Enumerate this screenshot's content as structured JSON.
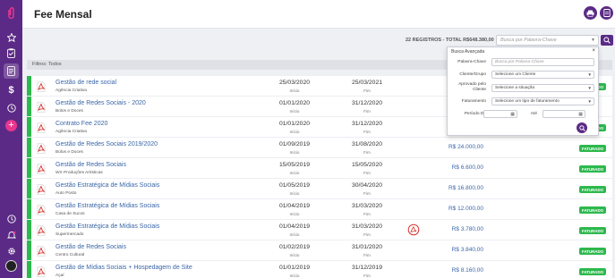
{
  "page": {
    "title": "Fee Mensal"
  },
  "summary": "22 REGISTROS - TOTAL R$648.380,00",
  "search": {
    "placeholder": "Busca por Palavra-Chave"
  },
  "filters": {
    "label": "Filtros: Todos"
  },
  "advanced_search": {
    "title": "Busca Avançada",
    "close": "×",
    "fields": [
      {
        "label": "Palavra-Chave",
        "value": "Busca por Palavra-Chave",
        "placeholder": true
      },
      {
        "label": "Cliente/Grupo",
        "value": "Selecione um Cliente"
      },
      {
        "label": "Aprovado pelo Cliente",
        "value": "Selecione a situação"
      },
      {
        "label": "Faturamento",
        "value": "Selecione um tipo de faturamento"
      }
    ],
    "period_label": "Período De",
    "period_to": "Até"
  },
  "colors": {
    "sidebar": "#5b2a86",
    "accent": "#e8368f",
    "link": "#3a66a8",
    "status": "#2db84d"
  },
  "sidebar": {
    "icons": [
      "logo-icon",
      "star-icon",
      "clipboard-icon",
      "document-icon",
      "dollar-icon",
      "clock-icon",
      "plus-icon",
      "history-icon",
      "bell-icon",
      "gear-icon",
      "avatar"
    ]
  },
  "date_labels": {
    "start": "Início",
    "end": "Fim"
  },
  "rows": [
    {
      "title": "Gestão de rede social",
      "client": "Agência Criativa",
      "start": "25/03/2020",
      "end": "25/03/2021",
      "amount": "",
      "status": "FATURADO"
    },
    {
      "title": "Gestão de Redes Sociais - 2020",
      "client": "Bolos e Doces",
      "start": "01/01/2020",
      "end": "31/12/2020",
      "amount": "",
      "status": ""
    },
    {
      "title": "Contrato Fee 2020",
      "client": "Agência Criativa",
      "start": "01/01/2020",
      "end": "31/12/2020",
      "amount": "",
      "status": "FATURADO"
    },
    {
      "title": "Gestão de Redes Sociais 2019/2020",
      "client": "Bolos e Doces",
      "start": "01/09/2019",
      "end": "31/08/2020",
      "amount": "R$ 24.000,00",
      "status": "FATURADO"
    },
    {
      "title": "Gestão de Redes Sociais",
      "client": "WX Produções Artísticas",
      "start": "15/05/2019",
      "end": "15/05/2020",
      "amount": "R$ 6.600,00",
      "status": "FATURADO"
    },
    {
      "title": "Gestão Estratégica de Mídias Sociais",
      "client": "Auto Posto",
      "start": "01/05/2019",
      "end": "30/04/2020",
      "amount": "R$ 16.800,00",
      "status": "FATURADO"
    },
    {
      "title": "Gestão Estratégica de Mídias Sociais",
      "client": "Casa de Sucos",
      "start": "01/04/2019",
      "end": "31/03/2020",
      "amount": "R$ 12.000,00",
      "status": "FATURADO"
    },
    {
      "title": "Gestão Estratégica de Mídias Sociais",
      "client": "Supermercado",
      "start": "01/04/2019",
      "end": "31/03/2020",
      "amount": "R$ 3.780,00",
      "status": "FATURADO",
      "alert": true
    },
    {
      "title": "Gestão de Redes Sociais",
      "client": "Centro Cultural",
      "start": "01/02/2019",
      "end": "31/01/2020",
      "amount": "R$ 3.840,00",
      "status": "FATURADO"
    },
    {
      "title": "Gestão de Mídias Sociais + Hospedagem de Site",
      "client": "Açaí",
      "start": "01/01/2019",
      "end": "31/12/2019",
      "amount": "R$ 8.160,00",
      "status": "FATURADO"
    }
  ]
}
